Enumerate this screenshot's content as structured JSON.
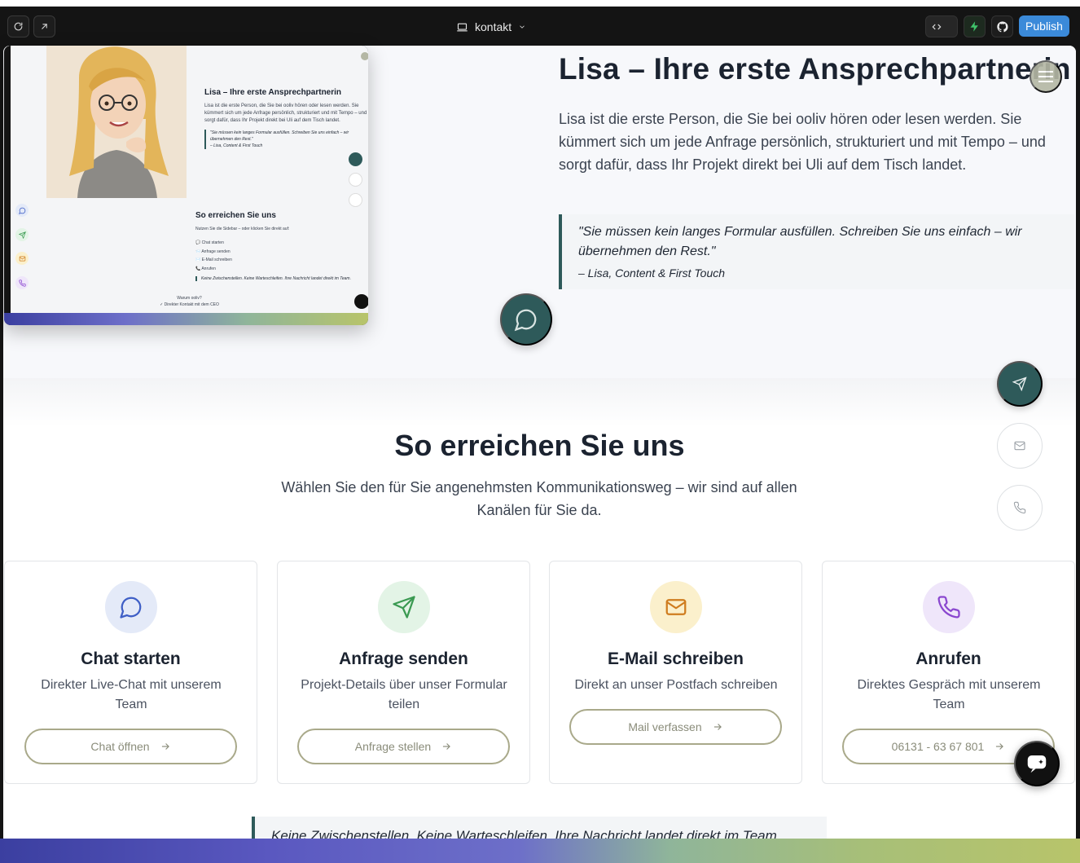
{
  "toolbar": {
    "page_name": "kontakt",
    "publish_label": "Publish",
    "refresh_icon": "refresh-icon",
    "open_icon": "external-link-icon",
    "code_icon": "code-icon",
    "bolt_icon": "bolt-icon",
    "github_icon": "github-icon"
  },
  "hero": {
    "title": "Lisa – Ihre erste Ansprechpartnerin",
    "text": "Lisa ist die erste Person, die Sie bei ooliv hören oder lesen werden. Sie kümmert sich um jede Anfrage persönlich, strukturiert und mit Tempo – und sorgt dafür, dass Ihr Projekt direkt bei Uli auf dem Tisch landet.",
    "quote": "\"Sie müssen kein langes Formular ausfüllen. Schreiben Sie uns einfach – wir übernehmen den Rest.\"",
    "quote_author": "– Lisa, Content & First Touch"
  },
  "contact_section": {
    "title": "So erreichen Sie uns",
    "subtitle": "Wählen Sie den für Sie angenehmsten Kommunikationsweg – wir sind auf allen Kanälen für Sie da.",
    "cards": [
      {
        "title": "Chat starten",
        "description": "Direkter Live-Chat mit unserem Team",
        "button": "Chat öffnen",
        "icon": "chat-icon",
        "color": "#e4eaf8",
        "stroke": "#3f5fc6"
      },
      {
        "title": "Anfrage senden",
        "description": "Projekt-Details über unser Formular teilen",
        "button": "Anfrage stellen",
        "icon": "send-icon",
        "color": "#e3f4e6",
        "stroke": "#3b9a52"
      },
      {
        "title": "E-Mail schreiben",
        "description": "Direkt an unser Postfach schreiben",
        "button": "Mail verfassen",
        "icon": "mail-icon",
        "color": "#fbf0cc",
        "stroke": "#cf7c1e"
      },
      {
        "title": "Anrufen",
        "description": "Direktes Gespräch mit unserem Team",
        "button": "06131 - 63 67 801",
        "icon": "phone-icon",
        "color": "#efe6fa",
        "stroke": "#8a47cf"
      }
    ],
    "footer_note": "Keine Zwischenstellen. Keine Warteschleifen. Ihre Nachricht landet direkt im Team."
  },
  "preview": {
    "title": "Lisa – Ihre erste Ansprechpartnerin",
    "text": "Lisa ist die erste Person, die Sie bei ooliv hören oder lesen werden. Sie kümmert sich um jede Anfrage persönlich, strukturiert und mit Tempo – und sorgt dafür, dass Ihr Projekt direkt bei Uli auf dem Tisch landet.",
    "quote": "\"Sie müssen kein langes Formular ausfüllen. Schreiben Sie uns einfach – wir übernehmen den Rest.\"",
    "quote_author": "– Lisa, Content & First Touch",
    "section_title": "So erreichen Sie uns",
    "section_sub": "Nutzen Sie die Sidebar – oder klicken Sie direkt auf:",
    "list": [
      "💬 Chat starten",
      "📨 Anfrage senden",
      "✉️ E-Mail schreiben",
      "📞 Anrufen"
    ],
    "note": "Keine Zwischenstellen. Keine Warteschleifen. Ihre Nachricht landet direkt im Team.",
    "footer_q": "Warum ooliv?",
    "footer_a": "✓ Direkter Kontakt mit dem CEO"
  },
  "colors": {
    "accent": "#2e5a5a",
    "publish": "#3b8ad9",
    "button_border": "#a9a98a"
  }
}
